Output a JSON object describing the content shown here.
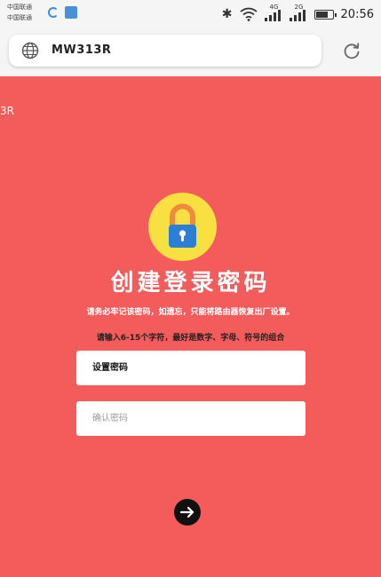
{
  "status_bar": {
    "carrier_1": "中国联通",
    "carrier_2": "中国联通",
    "network_1": "4G",
    "network_2": "2G",
    "time": "20:56",
    "battery_level": 0.8
  },
  "browser": {
    "url": "MW313R"
  },
  "page": {
    "edge_fragment": "3R",
    "title": "创建登录密码",
    "subtitle": "请务必牢记该密码，如遗忘，只能将路由器恢复出厂设置。",
    "hint": "请输入6-15个字符，最好是数字、字母、符号的组合",
    "password_placeholder": "设置密码",
    "confirm_placeholder": "确认密码"
  },
  "colors": {
    "page_background": "#f45b5b",
    "lock_circle": "#f7e040",
    "lock_shackle": "#f08a3c",
    "lock_body": "#2b7fd6"
  }
}
